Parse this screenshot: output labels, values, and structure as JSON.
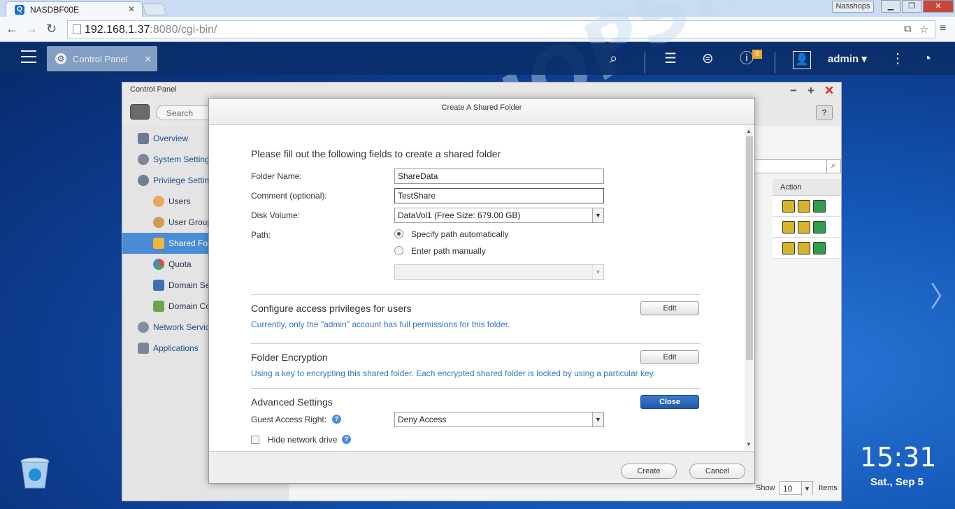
{
  "browser": {
    "tab_title": "NASDBF00E",
    "profile": "Nasshops",
    "url_host": "192.168.1.37",
    "url_rest": ":8080/cgi-bin/"
  },
  "topbar": {
    "app_tab_label": "Control Panel",
    "notification_count": "6",
    "user": "admin"
  },
  "control_panel": {
    "title": "Control Panel",
    "search_placeholder": "Search",
    "help": "?",
    "nav": [
      {
        "label": "Overview"
      },
      {
        "label": "System Settings"
      },
      {
        "label": "Privilege Settings"
      },
      {
        "label": "Users"
      },
      {
        "label": "User Groups"
      },
      {
        "label": "Shared Folders"
      },
      {
        "label": "Quota"
      },
      {
        "label": "Domain Security"
      },
      {
        "label": "Domain Controller"
      },
      {
        "label": "Network Services"
      },
      {
        "label": "Applications"
      }
    ],
    "action_header": "Action",
    "show_label": "Show",
    "show_value": "10",
    "items_label": "Items"
  },
  "dialog": {
    "title": "Create A Shared Folder",
    "intro": "Please fill out the following fields to create a shared folder",
    "folder_name_label": "Folder Name:",
    "folder_name_value": "ShareData",
    "comment_label": "Comment (optional):",
    "comment_value": "TestShare",
    "disk_volume_label": "Disk Volume:",
    "disk_volume_value": "DataVol1 (Free Size: 679.00 GB)",
    "path_label": "Path:",
    "path_auto": "Specify path automatically",
    "path_manual": "Enter path manually",
    "access_heading": "Configure access privileges for users",
    "access_desc": "Currently, only the \"admin\" account has full permissions for this folder.",
    "encryption_heading": "Folder Encryption",
    "encryption_desc": "Using a key to encrypting this shared folder. Each encrypted shared folder is locked by using a particular key.",
    "edit_label": "Edit",
    "advanced_heading": "Advanced Settings",
    "close_label": "Close",
    "guest_label": "Guest Access Right:",
    "guest_value": "Deny Access",
    "hide_drive_label": "Hide network drive",
    "create_label": "Create",
    "cancel_label": "Cancel"
  },
  "desktop": {
    "time": "15:31",
    "date": "Sat., Sep 5",
    "watermark": "NASSHOPS.net"
  }
}
